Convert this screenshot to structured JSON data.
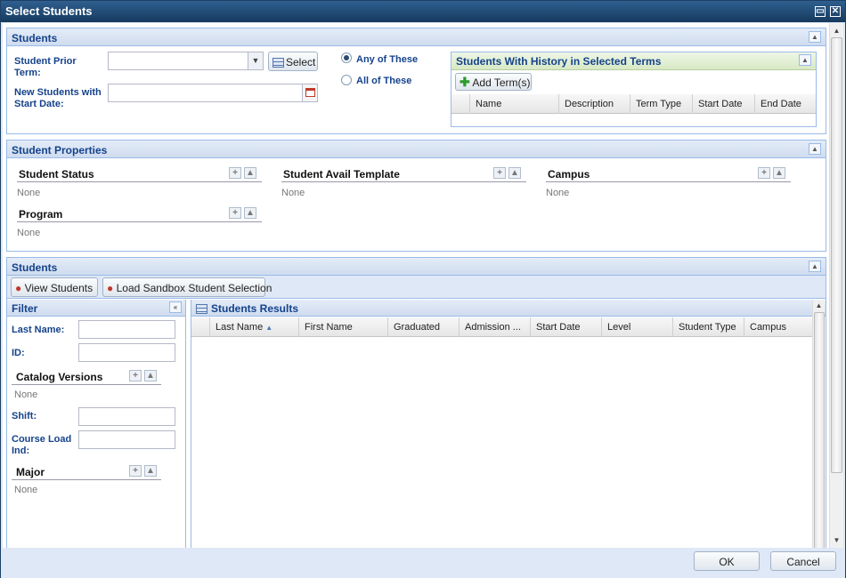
{
  "window": {
    "title": "Select Students"
  },
  "students_panel": {
    "title": "Students",
    "prior_term_label": "Student Prior Term:",
    "select_label": "Select",
    "new_students_label": "New Students with Start Date:",
    "radio_any": "Any of These",
    "radio_all": "All of These",
    "radio_selected": "any",
    "history": {
      "title": "Students With History in Selected Terms",
      "add_label": "Add Term(s)",
      "columns": [
        "Name",
        "Description",
        "Term Type",
        "Start Date",
        "End Date"
      ]
    }
  },
  "properties_panel": {
    "title": "Student Properties",
    "sections": [
      {
        "title": "Student Status",
        "value": "None"
      },
      {
        "title": "Student Avail Template",
        "value": "None"
      },
      {
        "title": "Campus",
        "value": "None"
      },
      {
        "title": "Program",
        "value": "None"
      }
    ]
  },
  "results_panel": {
    "title": "Students",
    "view_label": "View Students",
    "sandbox_label": "Load Sandbox Student Selection",
    "filter": {
      "title": "Filter",
      "last_name_label": "Last Name:",
      "id_label": "ID:",
      "catalog_title": "Catalog Versions",
      "catalog_value": "None",
      "shift_label": "Shift:",
      "course_load_label": "Course Load Ind:",
      "major_title": "Major",
      "major_value": "None"
    },
    "results": {
      "title": "Students Results",
      "columns": [
        "Last Name",
        "First Name",
        "Graduated",
        "Admission ...",
        "Start Date",
        "Level",
        "Student Type",
        "Campus"
      ],
      "sort_indicator": "▲"
    }
  },
  "footer": {
    "ok_label": "OK",
    "cancel_label": "Cancel"
  }
}
